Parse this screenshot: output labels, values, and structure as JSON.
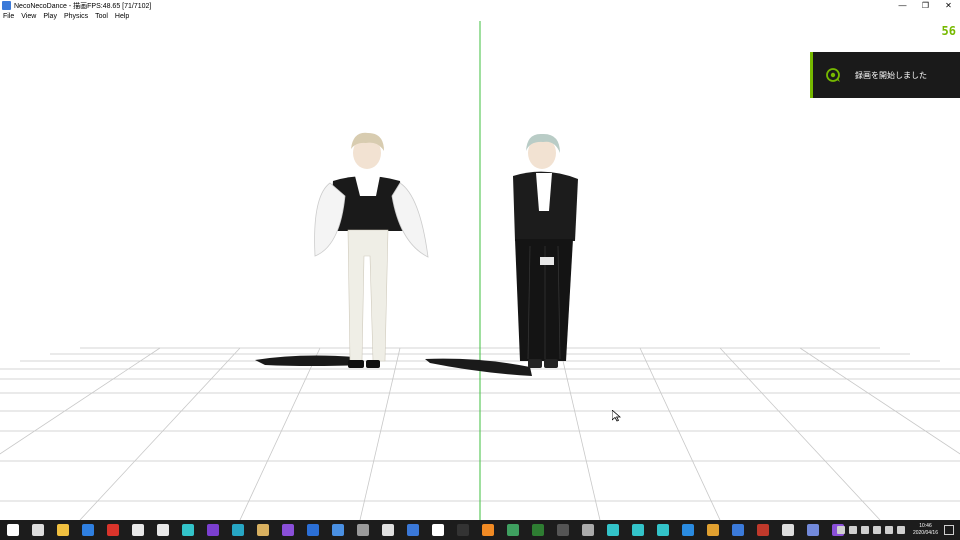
{
  "window": {
    "title": "NecoNecoDance - 描画FPS:48.65 [71/7102]",
    "controls": [
      "minimize",
      "maximize",
      "close"
    ]
  },
  "menu": [
    "File",
    "View",
    "Play",
    "Physics",
    "Tool",
    "Help"
  ],
  "overlay": {
    "fps": "56",
    "fps_color": "#76b900",
    "toast_text": "録画を開始しました",
    "toast_icon": "recording-icon"
  },
  "viewport": {
    "background": "#ffffff",
    "center_axis_color": "#3fbf3f",
    "grid_color": "#cccccc",
    "figures": [
      {
        "name": "model-left",
        "outfit": "white coat, black vest, white pants"
      },
      {
        "name": "model-right",
        "outfit": "black coat, black long skirt"
      }
    ]
  },
  "taskbar": {
    "apps": [
      {
        "icon": "windows-start-icon",
        "color": "#ffffff"
      },
      {
        "icon": "task-view-icon",
        "color": "#dddddd"
      },
      {
        "icon": "file-explorer-icon",
        "color": "#f0c040"
      },
      {
        "icon": "edge-icon",
        "color": "#2f7fe0"
      },
      {
        "icon": "vivaldi-icon",
        "color": "#d9342b"
      },
      {
        "icon": "film-icon",
        "color": "#e8e8e8"
      },
      {
        "icon": "film-icon-2",
        "color": "#e8e8e8"
      },
      {
        "icon": "miku-icon",
        "color": "#33c3c9"
      },
      {
        "icon": "app-purple-icon",
        "color": "#7b3fd0"
      },
      {
        "icon": "app-teal-icon",
        "color": "#27a6c4"
      },
      {
        "icon": "folder-app-icon",
        "color": "#d8b060"
      },
      {
        "icon": "visual-studio-icon",
        "color": "#8a4fd8"
      },
      {
        "icon": "maps-icon",
        "color": "#2b6fd6"
      },
      {
        "icon": "calculator-icon",
        "color": "#4a90e2"
      },
      {
        "icon": "app-gray-icon",
        "color": "#9a9a9a"
      },
      {
        "icon": "notepad-icon",
        "color": "#e0e0e0"
      },
      {
        "icon": "app-blue-icon",
        "color": "#3a78d8"
      },
      {
        "icon": "chrome-icon",
        "color": "#ffffff"
      },
      {
        "icon": "terminal-icon",
        "color": "#333333"
      },
      {
        "icon": "blender-icon",
        "color": "#f08a24"
      },
      {
        "icon": "app-green-icon",
        "color": "#3fa060"
      },
      {
        "icon": "spreadsheet-icon",
        "color": "#2e7d32"
      },
      {
        "icon": "app-dark-icon",
        "color": "#555555"
      },
      {
        "icon": "app-gear-icon",
        "color": "#aaaaaa"
      },
      {
        "icon": "miku-icon-2",
        "color": "#33c3c9"
      },
      {
        "icon": "miku-icon-3",
        "color": "#33c3c9"
      },
      {
        "icon": "miku-icon-4",
        "color": "#33c3c9"
      },
      {
        "icon": "vscode-icon",
        "color": "#2a8be0"
      },
      {
        "icon": "paint-icon",
        "color": "#e0a030"
      },
      {
        "icon": "neconeco-icon",
        "color": "#3b7ad9"
      },
      {
        "icon": "app-red-icon",
        "color": "#c0392b"
      },
      {
        "icon": "app-white-icon",
        "color": "#dddddd"
      },
      {
        "icon": "discord-icon",
        "color": "#7289da"
      },
      {
        "icon": "visual-studio-icon-2",
        "color": "#8a4fd8"
      }
    ],
    "clock_time": "10:46",
    "clock_date": "2020/04/16"
  }
}
